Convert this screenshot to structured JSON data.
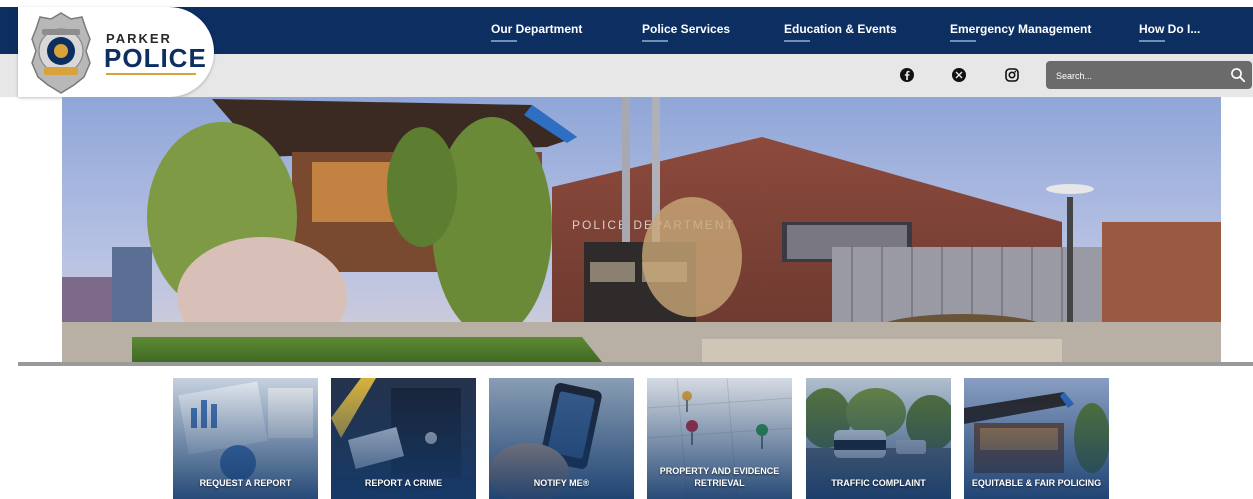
{
  "logo": {
    "top_text": "PARKER",
    "main_text": "POLICE"
  },
  "nav": {
    "items": [
      {
        "label": "Our Department"
      },
      {
        "label": "Police Services"
      },
      {
        "label": "Education & Events"
      },
      {
        "label": "Emergency Management"
      },
      {
        "label": "How Do I..."
      }
    ]
  },
  "social": {
    "icons": [
      "facebook-icon",
      "x-icon",
      "instagram-icon"
    ]
  },
  "search": {
    "placeholder": "Search..."
  },
  "hero": {
    "building_sign": "POLICE DEPARTMENT"
  },
  "tiles": [
    {
      "label": "REQUEST A REPORT"
    },
    {
      "label": "REPORT A CRIME"
    },
    {
      "label": "NOTIFY ME®"
    },
    {
      "label": "PROPERTY AND EVIDENCE RETRIEVAL"
    },
    {
      "label": "TRAFFIC COMPLAINT"
    },
    {
      "label": "EQUITABLE & FAIR POLICING"
    }
  ],
  "colors": {
    "nav_bg": "#0c2e61",
    "subbar_bg": "#e7e7e7",
    "search_bg": "#6b6b6b",
    "accent_gold": "#d9a23a",
    "tile_overlay": "#143a6b"
  }
}
